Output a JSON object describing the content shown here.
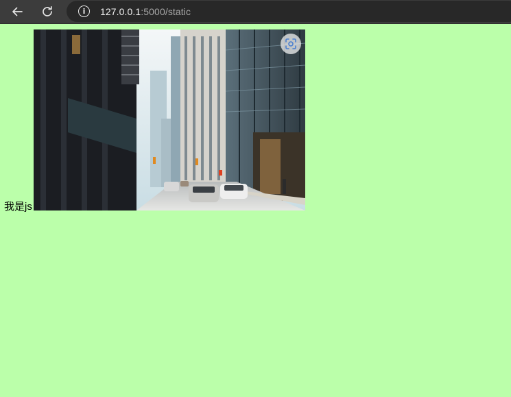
{
  "browser": {
    "url_host": "127.0.0.1",
    "url_rest": ":5000/static",
    "back_icon": "arrow-left-icon",
    "reload_icon": "reload-icon",
    "site_info_icon": "info-icon"
  },
  "page": {
    "background": "#bbffaa",
    "label_text": "我是js",
    "image": {
      "subject": "city street with skyscrapers and cars",
      "overlay_icon": "visual-search-icon"
    }
  }
}
